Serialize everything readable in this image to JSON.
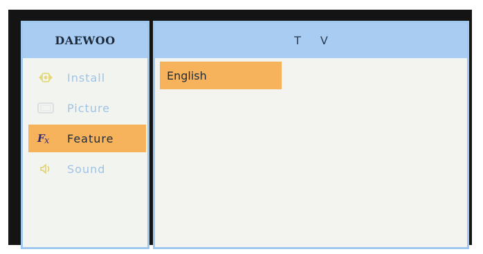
{
  "side": {
    "brand": "DAEWOO",
    "items": [
      {
        "label": "Install",
        "icon": "install-icon",
        "selected": false
      },
      {
        "label": "Picture",
        "icon": "picture-icon",
        "selected": false
      },
      {
        "label": "Feature",
        "icon": "feature-icon",
        "selected": true
      },
      {
        "label": "Sound",
        "icon": "speaker-icon",
        "selected": false
      }
    ]
  },
  "main": {
    "title": "TV",
    "options": [
      {
        "label": "English",
        "selected": true
      }
    ]
  },
  "colors": {
    "header_blue": "#a9cdf2",
    "panel_border": "#9fc8ee",
    "highlight_orange": "#f6b35c",
    "inactive_text": "#9fc3e6",
    "panel_background": "#f2f4ef"
  }
}
